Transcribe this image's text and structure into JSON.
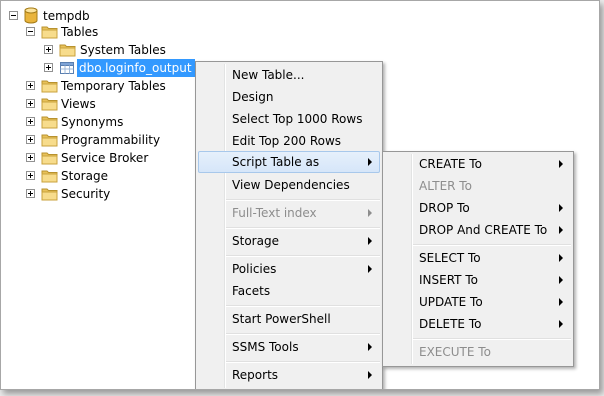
{
  "tree": {
    "root": {
      "label": "tempdb",
      "icon": "database-icon"
    },
    "tables": {
      "label": "Tables",
      "icon": "folder-icon"
    },
    "system_tables": {
      "label": "System Tables",
      "icon": "folder-icon"
    },
    "selected_table": {
      "label": "dbo.loginfo_output",
      "icon": "table-icon"
    },
    "folders": [
      {
        "label": "Temporary Tables"
      },
      {
        "label": "Views"
      },
      {
        "label": "Synonyms"
      },
      {
        "label": "Programmability"
      },
      {
        "label": "Service Broker"
      },
      {
        "label": "Storage"
      },
      {
        "label": "Security"
      }
    ]
  },
  "context_menu": {
    "items": [
      {
        "label": "New Table..."
      },
      {
        "label": "Design"
      },
      {
        "label": "Select Top 1000 Rows"
      },
      {
        "label": "Edit Top 200 Rows"
      },
      {
        "label": "Script Table as",
        "submenu": true,
        "highlighted": true
      },
      {
        "label": "View Dependencies"
      },
      {
        "label": "Full-Text index",
        "submenu": true,
        "disabled": true
      },
      {
        "label": "Storage",
        "submenu": true
      },
      {
        "label": "Policies",
        "submenu": true
      },
      {
        "label": "Facets"
      },
      {
        "label": "Start PowerShell"
      },
      {
        "label": "SSMS Tools",
        "submenu": true
      },
      {
        "label": "Reports",
        "submenu": true
      }
    ]
  },
  "submenu": {
    "items": [
      {
        "label": "CREATE To",
        "submenu": true
      },
      {
        "label": "ALTER To",
        "disabled": true
      },
      {
        "label": "DROP To",
        "submenu": true
      },
      {
        "label": "DROP And CREATE To",
        "submenu": true
      },
      {
        "label": "SELECT To",
        "submenu": true
      },
      {
        "label": "INSERT To",
        "submenu": true
      },
      {
        "label": "UPDATE To",
        "submenu": true
      },
      {
        "label": "DELETE To",
        "submenu": true
      },
      {
        "label": "EXECUTE To",
        "disabled": true
      }
    ]
  },
  "colors": {
    "selection": "#3399ff",
    "folder": "#f4d27a",
    "menu_bg": "#f0f0f0"
  }
}
